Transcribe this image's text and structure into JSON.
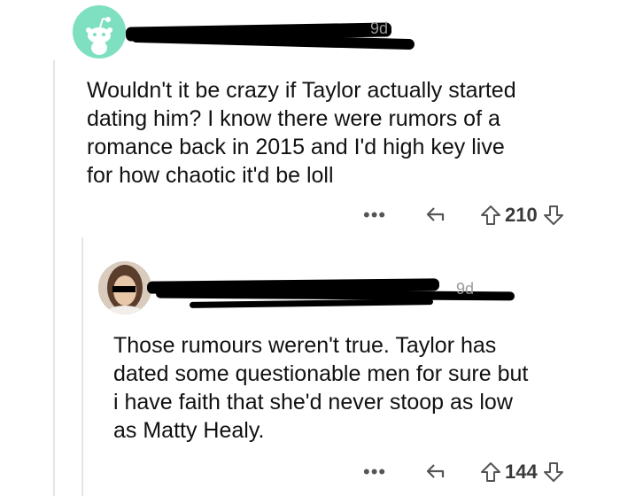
{
  "comments": [
    {
      "age": "9d",
      "body": "Wouldn't it be crazy if Taylor actually started\ndating him? I know there were rumors of a\nromance back in 2015 and I'd high key live\nfor how chaotic it'd be loll",
      "score": "210",
      "more_glyph": "•••"
    },
    {
      "age": "9d",
      "body": "Those rumours weren't true. Taylor has\ndated some questionable men for sure but\ni have faith that she'd never stoop as low\nas Matty Healy.",
      "score": "144",
      "more_glyph": "•••"
    }
  ],
  "icons": {
    "reply": "reply-arrow-icon",
    "upvote": "upvote-arrow-icon",
    "downvote": "downvote-arrow-icon",
    "avatar1": "reddit-snoo-avatar",
    "avatar2": "user-photo-avatar"
  },
  "colors": {
    "avatar1_bg": "#7ee0c1",
    "redaction": "#000000",
    "action_gray": "#555555"
  }
}
